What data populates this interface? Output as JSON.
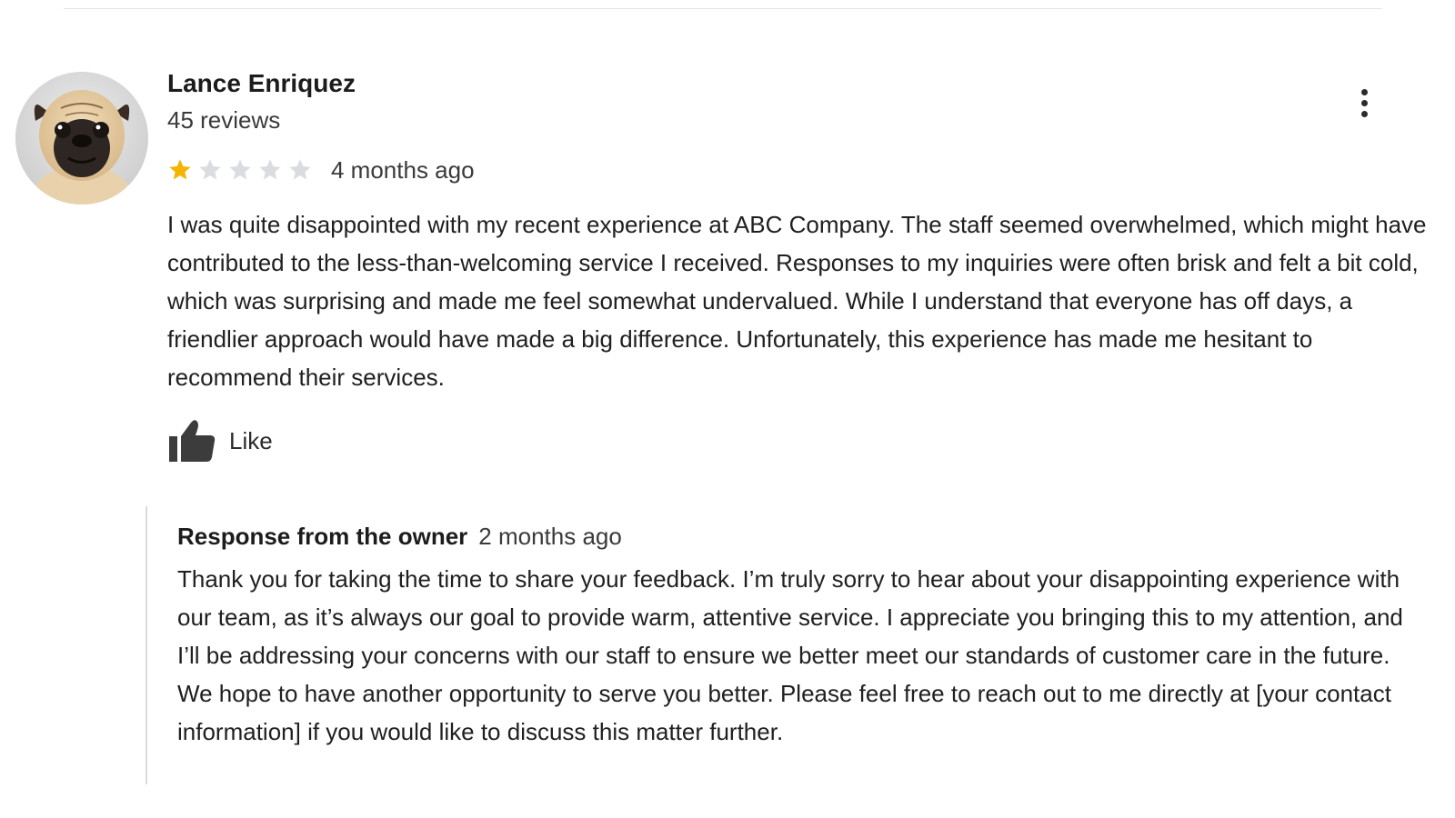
{
  "review": {
    "reviewer_name": "Lance Enriquez",
    "review_count": "45 reviews",
    "rating": 1,
    "max_rating": 5,
    "star_filled_color": "#f4b400",
    "star_empty_color": "#dadce0",
    "time_ago": "4 months ago",
    "text": "I was quite disappointed with my recent experience at ABC Company. The staff seemed overwhelmed, which might have contributed to the less-than-welcoming service I received. Responses to my inquiries were often brisk and felt a bit cold, which was surprising and made me feel somewhat undervalued. While I understand that everyone has off days, a friendlier approach would have made a big difference. Unfortunately, this experience has made me hesitant to recommend their services.",
    "like_label": "Like",
    "avatar": "pug-photo",
    "menu_icon": "more-vertical-icon",
    "like_icon": "thumbs-up-icon"
  },
  "owner_response": {
    "title": "Response from the owner",
    "time_ago": "2 months ago",
    "text": "Thank you for taking the time to share your feedback. I’m truly sorry to hear about your disappointing experience with our team, as it’s always our goal to provide warm, attentive service. I appreciate you bringing this to my attention, and I’ll be addressing your concerns with our staff to ensure we better meet our standards of customer care in the future. We hope to have another opportunity to serve you better. Please feel free to reach out to me directly at [your contact information] if you would like to discuss this matter further."
  }
}
